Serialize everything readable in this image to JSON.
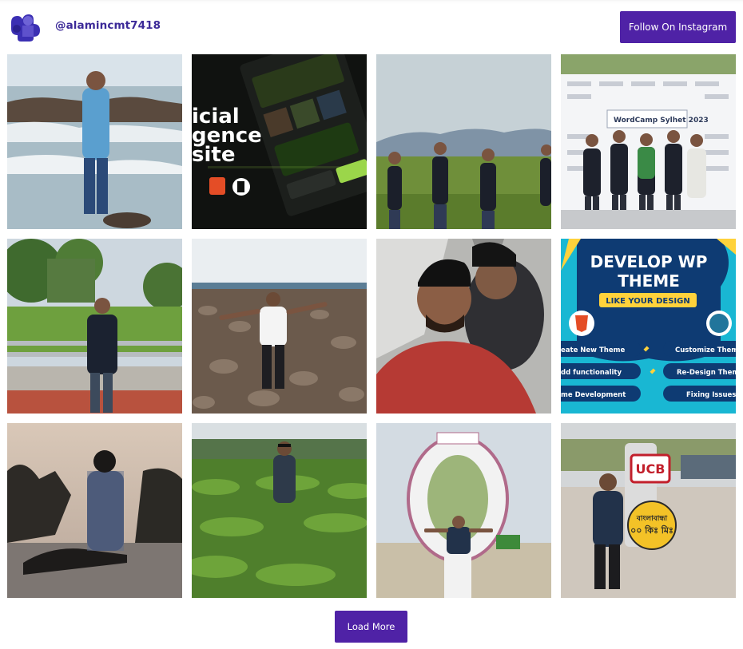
{
  "header": {
    "handle": "@alamincmt7418",
    "follow_label": "Follow On Instagram"
  },
  "footer": {
    "load_more_label": "Load More"
  },
  "posts": [
    {
      "alt": "man standing on rocky beach"
    },
    {
      "alt": "AI website design mockup",
      "text": [
        "icial",
        "gence",
        "site"
      ]
    },
    {
      "alt": "group of friends in a green field"
    },
    {
      "alt": "group photo at WordCamp Sylhet 2023",
      "text": [
        "WordCamp Sylhet 2023"
      ]
    },
    {
      "alt": "man standing by a railing in a park"
    },
    {
      "alt": "man posing on a stony beach"
    },
    {
      "alt": "two friends taking a selfie"
    },
    {
      "alt": "Develop WP Theme banner",
      "text": [
        "DEVELOP WP",
        "THEME",
        "LIKE YOUR DESIGN",
        "eate New Theme",
        "Customize Them",
        "dd functionality",
        "Re-Design Them",
        "me Development",
        "Fixing Issues"
      ]
    },
    {
      "alt": "man sitting at sunset"
    },
    {
      "alt": "man standing in a tea garden"
    },
    {
      "alt": "man sitting in front of a ring sculpture"
    },
    {
      "alt": "man standing beside a UCB signboard",
      "text": [
        "UCB",
        "বাংলাবান্ধা",
        "০০ কিঃ মিঃ"
      ]
    }
  ]
}
